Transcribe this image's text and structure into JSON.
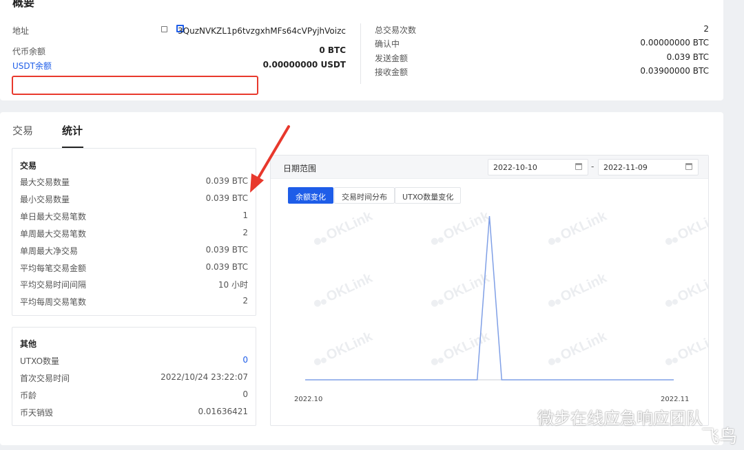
{
  "overview": {
    "title": "概要",
    "address_label": "地址",
    "address_value": "3QuzNVKZL1p6tvzgxhMFs64cVPyjhVoizc",
    "token_balance_label": "代币余额",
    "token_balance_value": "0 BTC",
    "usdt_label": "USDT余额",
    "usdt_value": "0.00000000 USDT",
    "total_tx_label": "总交易次数",
    "total_tx_value": "2",
    "confirming_label": "确认中",
    "confirming_value": "0.00000000 BTC",
    "sent_label": "发送金额",
    "sent_value": "0.039 BTC",
    "received_label": "接收金额",
    "received_value": "0.03900000 BTC"
  },
  "tabs": [
    {
      "label": "交易",
      "active": false
    },
    {
      "label": "统计",
      "active": true
    }
  ],
  "tx_stats": {
    "title": "交易",
    "rows": [
      {
        "label": "最大交易数量",
        "value": "0.039 BTC"
      },
      {
        "label": "最小交易数量",
        "value": "0.039 BTC"
      },
      {
        "label": "单日最大交易笔数",
        "value": "1"
      },
      {
        "label": "单周最大交易笔数",
        "value": "2"
      },
      {
        "label": "单周最大净交易",
        "value": "0.039 BTC"
      },
      {
        "label": "平均每笔交易金额",
        "value": "0.039 BTC"
      },
      {
        "label": "平均交易时间间隔",
        "value": "10 小时"
      },
      {
        "label": "平均每周交易笔数",
        "value": "2"
      }
    ]
  },
  "other_stats": {
    "title": "其他",
    "rows": [
      {
        "label": "UTXO数量",
        "value": "0"
      },
      {
        "label": "首次交易时间",
        "value": "2022/10/24 23:22:07"
      },
      {
        "label": "币龄",
        "value": "0"
      },
      {
        "label": "币天销毁",
        "value": "0.01636421"
      }
    ]
  },
  "chart_panel": {
    "date_range_label": "日期范围",
    "start_date": "2022-10-10",
    "date_separator": "-",
    "end_date": "2022-11-09",
    "chips": [
      {
        "label": "余额变化",
        "active": true
      },
      {
        "label": "交易时间分布",
        "active": false
      },
      {
        "label": "UTXO数量变化",
        "active": false
      }
    ],
    "watermark": "OKLink"
  },
  "chart_data": {
    "type": "line",
    "x": [
      "2022-10-10",
      "2022-10-24",
      "2022-10-25",
      "2022-10-26",
      "2022-11-09"
    ],
    "series": [
      {
        "values": [
          0,
          0,
          0.039,
          0,
          0
        ]
      }
    ],
    "x_tick_labels": [
      "2022.10",
      "2022.11"
    ],
    "ylim": [
      0,
      0.039
    ],
    "grid": false,
    "color": "#7f9fe6"
  },
  "page_watermark": {
    "text": "微步在线应急响应团队",
    "corner_text": "飞鸟"
  },
  "colors": {
    "accent": "#1e5de8",
    "highlight": "#e8382c"
  }
}
